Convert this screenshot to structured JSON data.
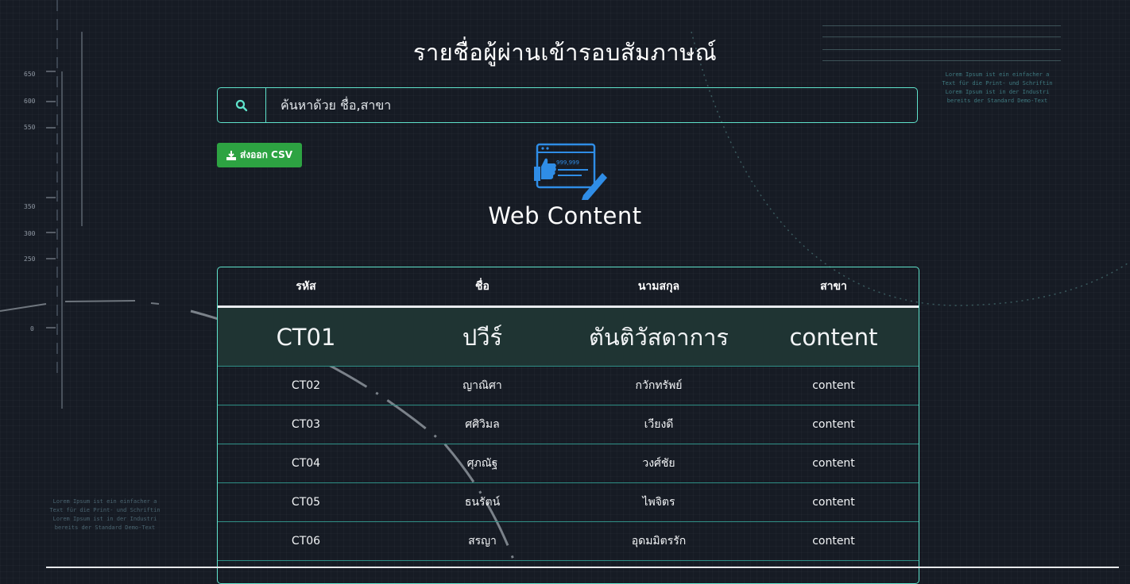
{
  "page": {
    "title": "รายชื่อผู้ผ่านเข้ารอบสัมภาษณ์",
    "accent_color": "#5fe3cc",
    "background_color": "#161b24"
  },
  "search": {
    "icon": "search-icon",
    "placeholder": "ค้นหาด้วย ชื่อ,สาขา",
    "value": ""
  },
  "export": {
    "icon": "download-icon",
    "label": "ส่งออก CSV",
    "color": "#2da342"
  },
  "department": {
    "icon": "web-content-icon",
    "title": "Web Content",
    "icon_text": "999,999"
  },
  "table": {
    "headers": [
      "รหัส",
      "ชื่อ",
      "นามสกุล",
      "สาขา"
    ],
    "rows": [
      [
        "CT01",
        "ปวีร์",
        "ตันติวัสดาการ",
        "content"
      ],
      [
        "CT02",
        "ญาณิศา",
        "กวักทรัพย์",
        "content"
      ],
      [
        "CT03",
        "ศศิวิมล",
        "เวียงดี",
        "content"
      ],
      [
        "CT04",
        "ศุภณัฐ",
        "วงศ์ชัย",
        "content"
      ],
      [
        "CT05",
        "ธนรัตน์",
        "ไพจิตร",
        "content"
      ],
      [
        "CT06",
        "สรญา",
        "อุดมมิตรรัก",
        "content"
      ],
      [
        "",
        "",
        "",
        ""
      ]
    ]
  },
  "decor": {
    "ruler_labels": [
      "650",
      "600",
      "550",
      "350",
      "300",
      "250",
      "0"
    ],
    "note_left": "Lorem Ipsum ist ein einfacher a\nText für die Print- und Schriftin\nLorem Ipsum ist in der Industri\nbereits der Standard Demo-Text",
    "note_right": "Lorem Ipsum ist ein einfacher a\nText für die Print- und Schriftin\nLorem Ipsum ist in der Industri\nbereits der Standard Demo-Text"
  }
}
